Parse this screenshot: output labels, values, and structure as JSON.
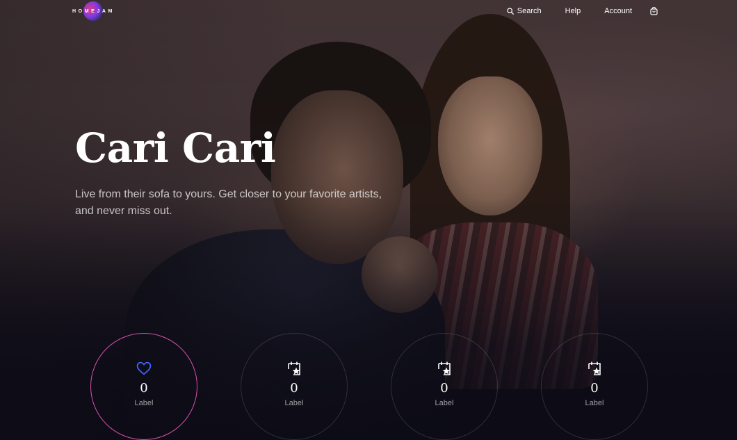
{
  "brand": {
    "logo_text": "HOMEJAM"
  },
  "nav": {
    "search_label": "Search",
    "help_label": "Help",
    "account_label": "Account",
    "cart_icon": "shopping-bag-icon"
  },
  "hero": {
    "title": "Cari Cari",
    "subtitle": "Live from their sofa to yours. Get closer to your favorite artists, and never miss out."
  },
  "stats": [
    {
      "icon": "heart-icon",
      "value": "0",
      "label": "Label",
      "active": true,
      "icon_color": "#3f63ff"
    },
    {
      "icon": "calendar-star-icon",
      "value": "0",
      "label": "Label",
      "active": false
    },
    {
      "icon": "calendar-star-icon",
      "value": "0",
      "label": "Label",
      "active": false
    },
    {
      "icon": "calendar-star-icon",
      "value": "0",
      "label": "Label",
      "active": false
    }
  ],
  "colors": {
    "accent_ring": "#d84fb0",
    "heart": "#3f63ff",
    "background": "#0e0d18"
  }
}
